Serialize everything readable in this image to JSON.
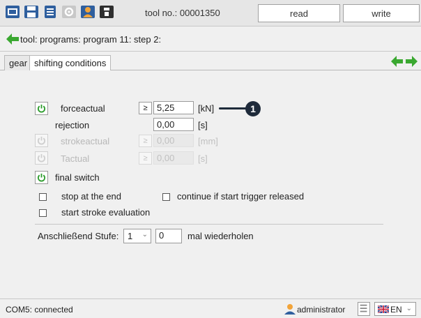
{
  "toolbar": {
    "icons": [
      "folder-icon",
      "save-icon",
      "database-icon",
      "settings-icon",
      "user-upload-icon",
      "device-icon"
    ],
    "tool_no_label": "tool no.: 00001350",
    "read_label": "read",
    "write_label": "write"
  },
  "breadcrumb": {
    "text": "tool: programs: program 11: step 2:"
  },
  "tabs": [
    {
      "label": "gear",
      "active": false
    },
    {
      "label": "shifting conditions",
      "active": true
    }
  ],
  "conditions": {
    "forceactual": {
      "label": "forceactual",
      "comparator": "≥",
      "value": "5,25",
      "unit": "[kN]",
      "enabled": true
    },
    "rejection": {
      "label": "rejection",
      "value": "0,00",
      "unit": "[s]"
    },
    "strokeactual": {
      "label": "strokeactual",
      "comparator": "≥",
      "value": "0,00",
      "unit": "[mm]",
      "enabled": false
    },
    "tactual": {
      "label": "Tactual",
      "comparator": "≥",
      "value": "0,00",
      "unit": "[s]",
      "enabled": false
    },
    "final_switch": {
      "label": "final switch",
      "enabled": true
    }
  },
  "options": {
    "stop_at_end": {
      "label": "stop at the end",
      "checked": false
    },
    "continue_trigger": {
      "label": "continue if start trigger released",
      "checked": false
    },
    "start_stroke_eval": {
      "label": "start stroke evaluation",
      "checked": false
    }
  },
  "next_step": {
    "label": "Anschließend Stufe:",
    "stage_value": "1",
    "repeat_value": "0",
    "repeat_label": "mal wiederholen"
  },
  "callout": {
    "number": "1"
  },
  "status": {
    "connection": "COM5: connected",
    "user": "administrator",
    "language": "EN"
  },
  "colors": {
    "power_on": "#2e9d2e",
    "arrow_green": "#3aa830",
    "callout": "#1e2a3a"
  }
}
